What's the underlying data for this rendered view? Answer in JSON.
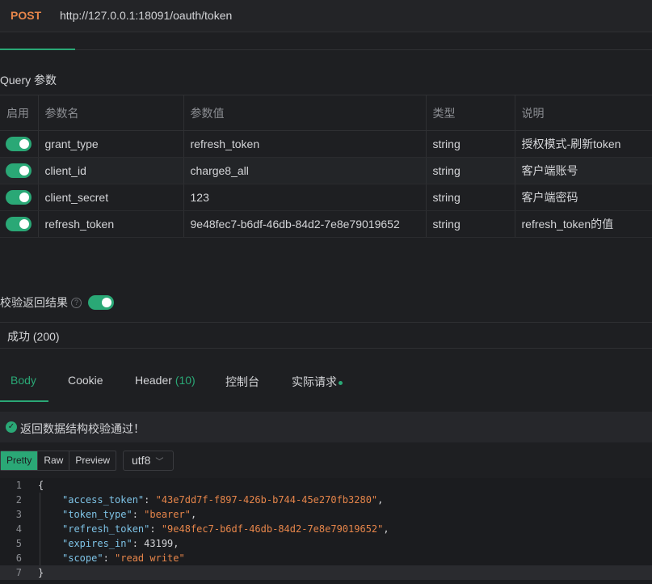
{
  "request": {
    "method": "POST",
    "url": "http://127.0.0.1:18091/oauth/token"
  },
  "query_section_title": "Query 参数",
  "params_table": {
    "headers": [
      "启用",
      "参数名",
      "参数值",
      "类型",
      "说明"
    ],
    "rows": [
      {
        "enabled": true,
        "name": "grant_type",
        "value": "refresh_token",
        "type": "string",
        "desc": "授权模式-刷新token"
      },
      {
        "enabled": true,
        "name": "client_id",
        "value": "charge8_all",
        "type": "string",
        "desc": "客户端账号"
      },
      {
        "enabled": true,
        "name": "client_secret",
        "value": "123",
        "type": "string",
        "desc": "客户端密码"
      },
      {
        "enabled": true,
        "name": "refresh_token",
        "value": "9e48fec7-b6df-46db-84d2-7e8e79019652",
        "type": "string",
        "desc": "refresh_token的值"
      }
    ]
  },
  "validate": {
    "label": "校验返回结果",
    "help_glyph": "?",
    "enabled": true
  },
  "response": {
    "status": "成功 (200)",
    "tabs": [
      {
        "label": "Body",
        "active": true
      },
      {
        "label": "Cookie"
      },
      {
        "label": "Header ",
        "count": "(10)"
      },
      {
        "label": "控制台"
      },
      {
        "label": "实际请求",
        "dot": true
      }
    ],
    "validation_message": "返回数据结构校验通过！",
    "format_buttons": [
      "Pretty",
      "Raw",
      "Preview"
    ],
    "encoding": "utf8",
    "body_lines": [
      {
        "num": "1",
        "text": "{"
      },
      {
        "num": "2",
        "key": "\"access_token\"",
        "val": "\"43e7dd7f-f897-426b-b744-45e270fb3280\"",
        "tail": ","
      },
      {
        "num": "3",
        "key": "\"token_type\"",
        "val": "\"bearer\"",
        "tail": ","
      },
      {
        "num": "4",
        "key": "\"refresh_token\"",
        "val": "\"9e48fec7-b6df-46db-84d2-7e8e79019652\"",
        "tail": ","
      },
      {
        "num": "5",
        "key": "\"expires_in\"",
        "val": "43199",
        "tail": ","
      },
      {
        "num": "6",
        "key": "\"scope\"",
        "val": "\"read write\"",
        "tail": ""
      },
      {
        "num": "7",
        "text": "}"
      }
    ]
  },
  "colors": {
    "accent": "#2aa876",
    "method": "#e6854a",
    "json_key": "#7ec3e6",
    "json_string": "#e6854a"
  },
  "icons": {
    "check": "check-circle-icon",
    "help": "question-circle-icon",
    "chevron": "chevron-down-icon"
  }
}
